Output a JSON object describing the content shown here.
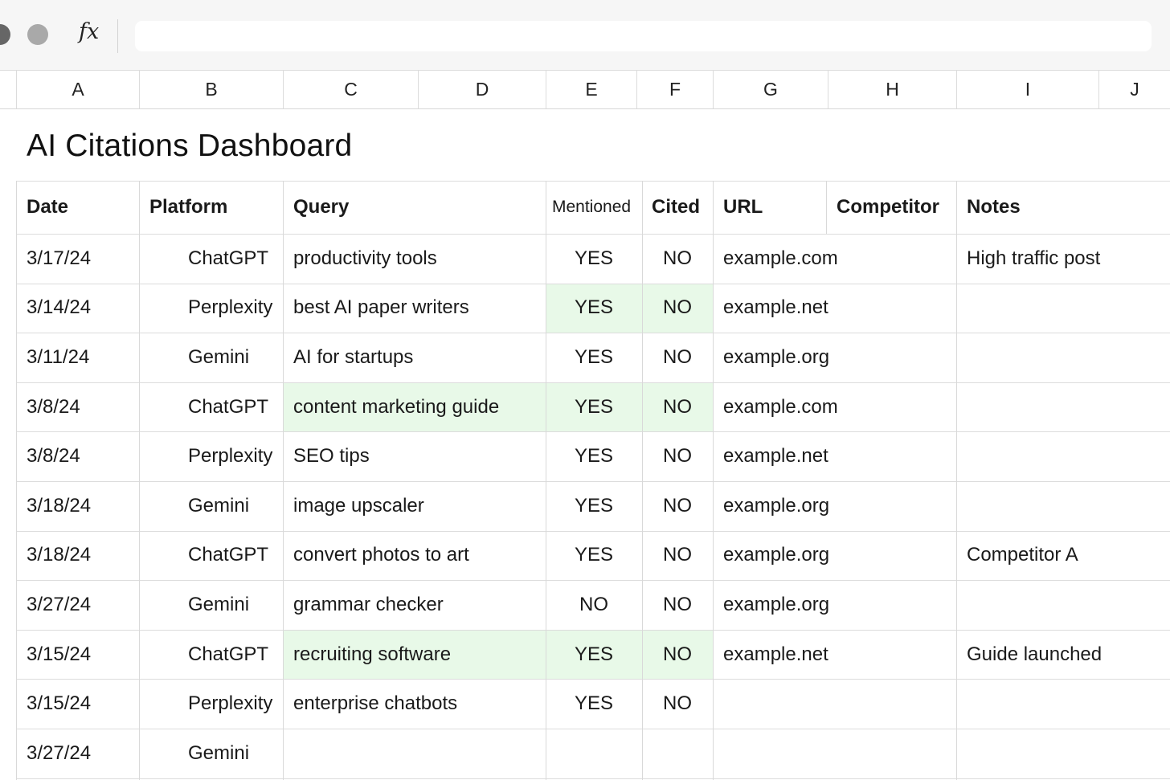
{
  "formula_bar": {
    "fx_label": "fx",
    "value": ""
  },
  "columns": [
    "A",
    "B",
    "C",
    "D",
    "E",
    "F",
    "G",
    "H",
    "I",
    "J"
  ],
  "sheet": {
    "title": "AI Citations Dashboard",
    "headers": {
      "date": "Date",
      "platform": "Platform",
      "query": "Query",
      "mentioned": "Mentioned",
      "cited": "Cited",
      "url": "URL",
      "competitor": "Competitor",
      "notes": "Notes"
    },
    "rows": [
      {
        "date": "3/17/24",
        "platform": "ChatGPT",
        "query": "productivity tools",
        "mentioned": "YES",
        "cited": "NO",
        "url": "example.com",
        "notes": "High traffic post",
        "hl_query": false,
        "hl_flags": false
      },
      {
        "date": "3/14/24",
        "platform": "Perplexity",
        "query": "best AI paper writers",
        "mentioned": "YES",
        "cited": "NO",
        "url": "example.net",
        "notes": "",
        "hl_query": false,
        "hl_flags": true
      },
      {
        "date": "3/11/24",
        "platform": "Gemini",
        "query": "AI for startups",
        "mentioned": "YES",
        "cited": "NO",
        "url": "example.org",
        "notes": "",
        "hl_query": false,
        "hl_flags": false
      },
      {
        "date": "3/8/24",
        "platform": "ChatGPT",
        "query": "content marketing guide",
        "mentioned": "YES",
        "cited": "NO",
        "url": "example.com",
        "notes": "",
        "hl_query": true,
        "hl_flags": true
      },
      {
        "date": "3/8/24",
        "platform": "Perplexity",
        "query": "SEO tips",
        "mentioned": "YES",
        "cited": "NO",
        "url": "example.net",
        "notes": "",
        "hl_query": false,
        "hl_flags": false
      },
      {
        "date": "3/18/24",
        "platform": "Gemini",
        "query": "image upscaler",
        "mentioned": "YES",
        "cited": "NO",
        "url": "example.org",
        "notes": "",
        "hl_query": false,
        "hl_flags": false
      },
      {
        "date": "3/18/24",
        "platform": "ChatGPT",
        "query": "convert photos to art",
        "mentioned": "YES",
        "cited": "NO",
        "url": "example.org",
        "notes": "Competitor A",
        "hl_query": false,
        "hl_flags": false
      },
      {
        "date": "3/27/24",
        "platform": "Gemini",
        "query": "grammar checker",
        "mentioned": "NO",
        "cited": "NO",
        "url": "example.org",
        "notes": "",
        "hl_query": false,
        "hl_flags": false
      },
      {
        "date": "3/15/24",
        "platform": "ChatGPT",
        "query": "recruiting software",
        "mentioned": "YES",
        "cited": "NO",
        "url": "example.net",
        "notes": "Guide launched",
        "hl_query": true,
        "hl_flags": true
      },
      {
        "date": "3/15/24",
        "platform": "Perplexity",
        "query": "enterprise chatbots",
        "mentioned": "YES",
        "cited": "NO",
        "url": "",
        "notes": "",
        "hl_query": false,
        "hl_flags": false
      },
      {
        "date": "3/27/24",
        "platform": "Gemini",
        "query": "",
        "mentioned": "",
        "cited": "",
        "url": "",
        "notes": "",
        "hl_query": false,
        "hl_flags": false
      }
    ]
  },
  "colors": {
    "highlight": "#e8f9e8",
    "grid": "#d9d9d9",
    "toolbar": "#f6f6f6"
  }
}
